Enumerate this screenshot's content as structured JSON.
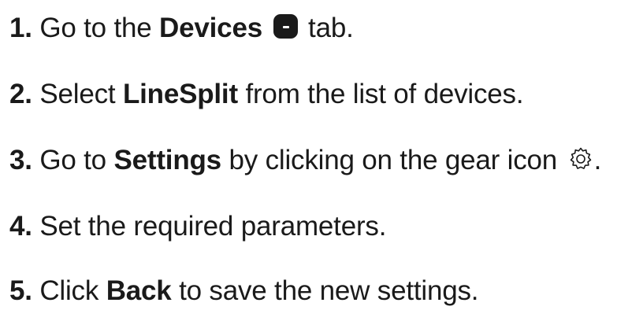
{
  "steps": [
    {
      "num": "1.",
      "parts": [
        "Go to the ",
        "Devices",
        " tab."
      ],
      "icon": "devices-tab-icon"
    },
    {
      "num": "2.",
      "parts": [
        "Select ",
        "LineSplit",
        " from the list of devices."
      ]
    },
    {
      "num": "3.",
      "parts": [
        "Go to ",
        "Settings",
        " by clicking on the gear icon ",
        "."
      ],
      "icon": "gear-icon"
    },
    {
      "num": "4.",
      "parts": [
        "Set the required parameters."
      ]
    },
    {
      "num": "5.",
      "parts": [
        "Click ",
        "Back",
        " to save the new settings."
      ]
    }
  ]
}
